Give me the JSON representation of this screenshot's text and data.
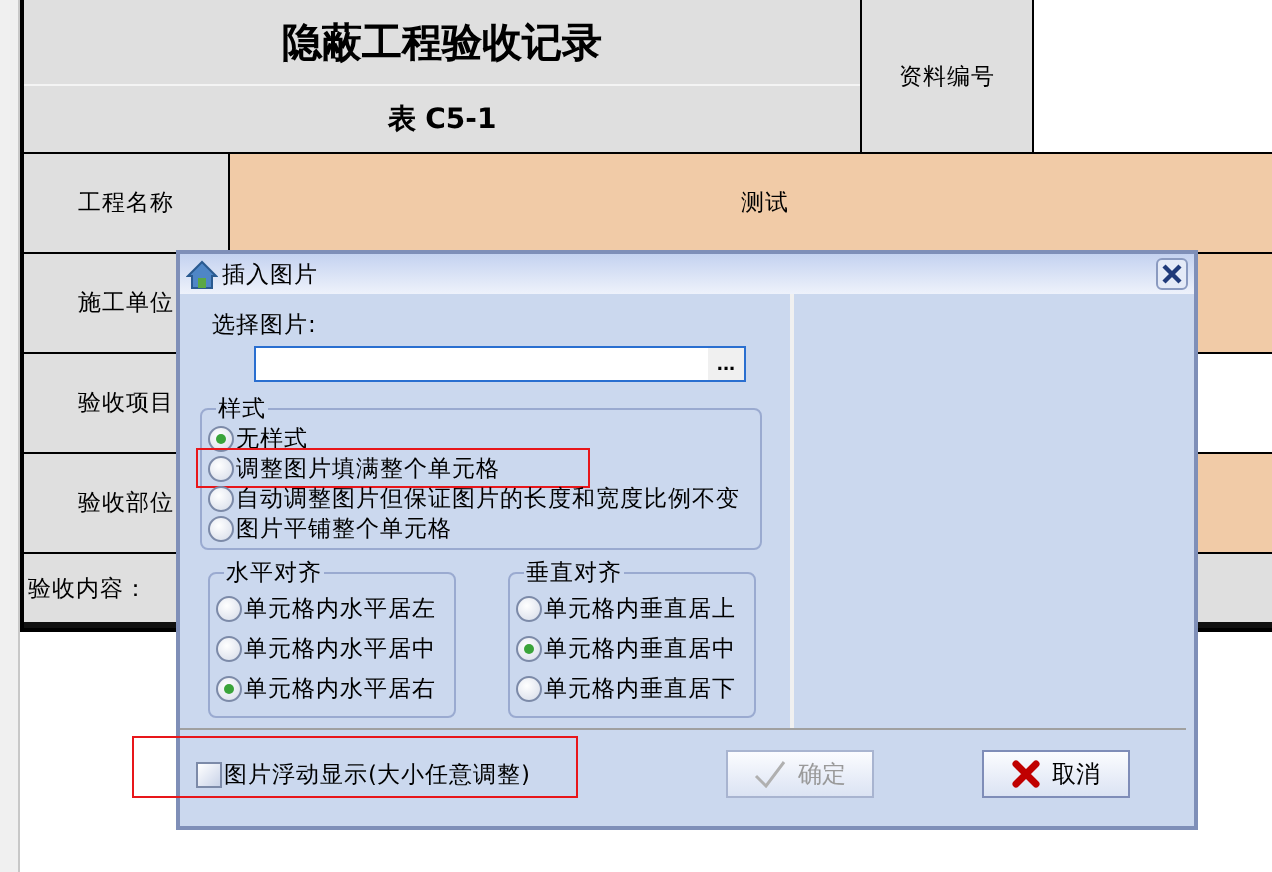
{
  "sheet": {
    "title": "隐蔽工程验收记录",
    "subtitle": "表 C5-1",
    "doc_no_label": "资料编号",
    "rows": [
      {
        "label": "工程名称",
        "value": "测试",
        "filled": true
      },
      {
        "label": "施工单位",
        "filled": true
      },
      {
        "label": "验收项目",
        "filled": false
      },
      {
        "label": "验收部位",
        "filled": true
      }
    ],
    "content_label": "验收内容："
  },
  "dialog": {
    "title": "插入图片",
    "file_label": "选择图片:",
    "browse": "...",
    "style_group": {
      "title": "样式",
      "options": [
        {
          "label": "无样式",
          "selected": true,
          "highlighted": false
        },
        {
          "label": "调整图片填满整个单元格",
          "selected": false,
          "highlighted": true
        },
        {
          "label": "自动调整图片但保证图片的长度和宽度比例不变",
          "selected": false,
          "highlighted": false
        },
        {
          "label": "图片平铺整个单元格",
          "selected": false,
          "highlighted": false
        }
      ]
    },
    "h_align": {
      "title": "水平对齐",
      "options": [
        {
          "label": "单元格内水平居左",
          "selected": false
        },
        {
          "label": "单元格内水平居中",
          "selected": false
        },
        {
          "label": "单元格内水平居右",
          "selected": true
        }
      ]
    },
    "v_align": {
      "title": "垂直对齐",
      "options": [
        {
          "label": "单元格内垂直居上",
          "selected": false
        },
        {
          "label": "单元格内垂直居中",
          "selected": true
        },
        {
          "label": "单元格内垂直居下",
          "selected": false
        }
      ]
    },
    "float_checkbox": {
      "label": "图片浮动显示(大小任意调整)",
      "checked": false,
      "highlighted": true
    },
    "buttons": [
      {
        "kind": "ok",
        "label": "确定",
        "disabled": true
      },
      {
        "kind": "cancel",
        "label": "取消",
        "disabled": false
      }
    ]
  }
}
